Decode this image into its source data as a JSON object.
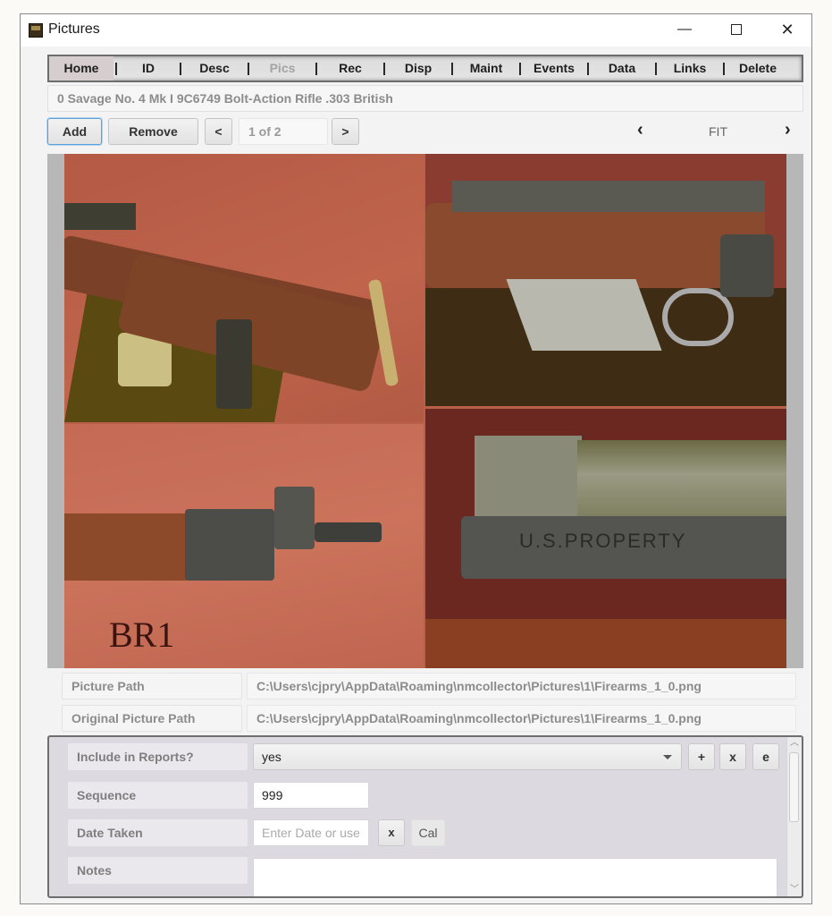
{
  "window": {
    "title": "Pictures",
    "controls": {
      "minimize": "—",
      "maximize": "",
      "close": "✕"
    }
  },
  "nav": {
    "items": [
      {
        "label": "Home",
        "state": "active"
      },
      {
        "label": "ID",
        "state": "normal"
      },
      {
        "label": "Desc",
        "state": "normal"
      },
      {
        "label": "Pics",
        "state": "disabled"
      },
      {
        "label": "Rec",
        "state": "normal"
      },
      {
        "label": "Disp",
        "state": "normal"
      },
      {
        "label": "Maint",
        "state": "normal"
      },
      {
        "label": "Events",
        "state": "normal"
      },
      {
        "label": "Data",
        "state": "normal"
      },
      {
        "label": "Links",
        "state": "normal"
      },
      {
        "label": "Delete",
        "state": "normal"
      }
    ],
    "separator": "|"
  },
  "record": {
    "title": "0 Savage  No. 4 Mk I 9C6749 Bolt-Action Rifle .303 British"
  },
  "toolbar": {
    "add_label": "Add",
    "remove_label": "Remove",
    "prev_label": "<",
    "next_label": ">",
    "page_indicator": "1 of 2",
    "zoom_prev": "‹",
    "zoom_label": "FIT",
    "zoom_next": "›"
  },
  "picture": {
    "description": "Collage of four photos of a rifle: buttstock, receiver with magazine, muzzle with front sight, receiver marking",
    "caption_text": "BR1",
    "marking_text": "U.S.PROPERTY"
  },
  "paths": {
    "picture_path_label": "Picture Path",
    "picture_path_value": "C:\\Users\\cjpry\\AppData\\Roaming\\nmcollector\\Pictures\\1\\Firearms_1_0.png",
    "original_path_label": "Original Picture Path",
    "original_path_value": "C:\\Users\\cjpry\\AppData\\Roaming\\nmcollector\\Pictures\\1\\Firearms_1_0.png"
  },
  "details": {
    "include_label": "Include in Reports?",
    "include_value": "yes",
    "include_add": "+",
    "include_remove": "x",
    "include_edit": "e",
    "sequence_label": "Sequence",
    "sequence_value": "999",
    "date_label": "Date Taken",
    "date_placeholder": "Enter Date or use",
    "date_clear": "x",
    "date_cal": "Cal",
    "notes_label": "Notes",
    "notes_value": ""
  },
  "scrollbar": {
    "up": "︿",
    "down": "﹀"
  }
}
